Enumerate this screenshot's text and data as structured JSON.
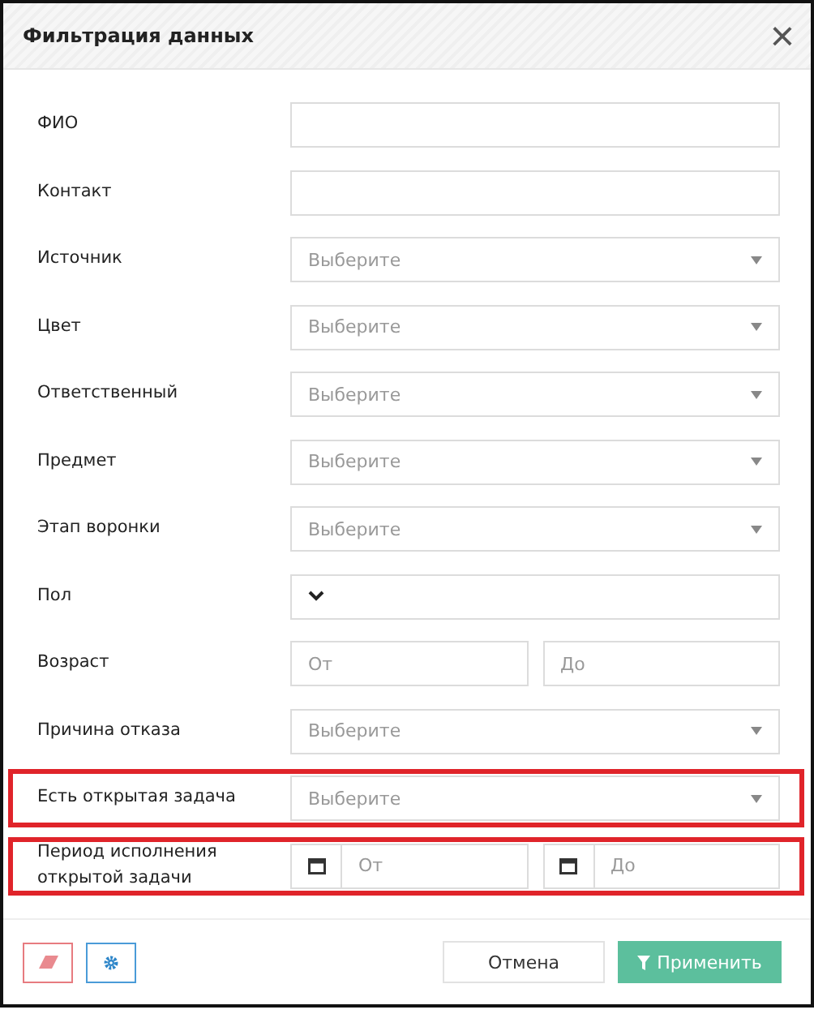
{
  "window": {
    "title": "Фильтрация данных",
    "close": "×"
  },
  "fields": [
    {
      "kind": "text",
      "label": "ФИО",
      "highlighted": false
    },
    {
      "kind": "text",
      "label": "Контакт",
      "highlighted": false
    },
    {
      "kind": "select",
      "label": "Источник",
      "placeholder": "Выберите",
      "highlighted": false
    },
    {
      "kind": "select",
      "label": "Цвет",
      "placeholder": "Выберите",
      "highlighted": false
    },
    {
      "kind": "select",
      "label": "Ответственный",
      "placeholder": "Выберите",
      "highlighted": false
    },
    {
      "kind": "select",
      "label": "Предмет",
      "placeholder": "Выберите",
      "highlighted": false
    },
    {
      "kind": "select",
      "label": "Этап воронки",
      "placeholder": "Выберите",
      "highlighted": false
    },
    {
      "kind": "native",
      "label": "Пол",
      "highlighted": false
    },
    {
      "kind": "range",
      "label": "Возраст",
      "inputs": [
        {
          "placeholder": "От"
        },
        {
          "placeholder": "До"
        }
      ],
      "highlighted": false
    },
    {
      "kind": "select",
      "label": "Причина отказа",
      "placeholder": "Выберите",
      "highlighted": false
    },
    {
      "kind": "select",
      "label": "Есть открытая задача",
      "placeholder": "Выберите",
      "highlighted": true
    },
    {
      "kind": "daterange",
      "label": "Период исполнения открытой задачи",
      "inputs": [
        {
          "placeholder": "От"
        },
        {
          "placeholder": "До"
        }
      ],
      "highlighted": true
    }
  ],
  "footer": {
    "cancel": "Отмена",
    "apply": "Применить"
  }
}
